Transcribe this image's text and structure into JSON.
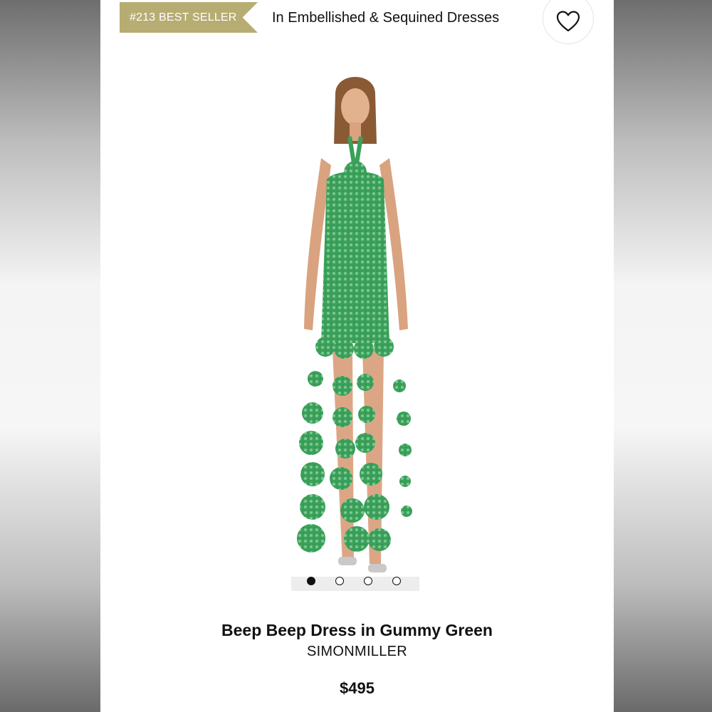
{
  "badge": {
    "text": "#213 BEST SELLER",
    "color": "#b7ac72"
  },
  "category": {
    "text": "In Embellished & Sequined Dresses"
  },
  "favorite": {
    "icon": "heart-icon"
  },
  "gallery": {
    "total": 4,
    "active_index": 0
  },
  "product": {
    "name": "Beep Beep Dress in Gummy Green",
    "brand": "SIMONMILLER",
    "price": "$495",
    "dress_color": "#3aa05a"
  }
}
